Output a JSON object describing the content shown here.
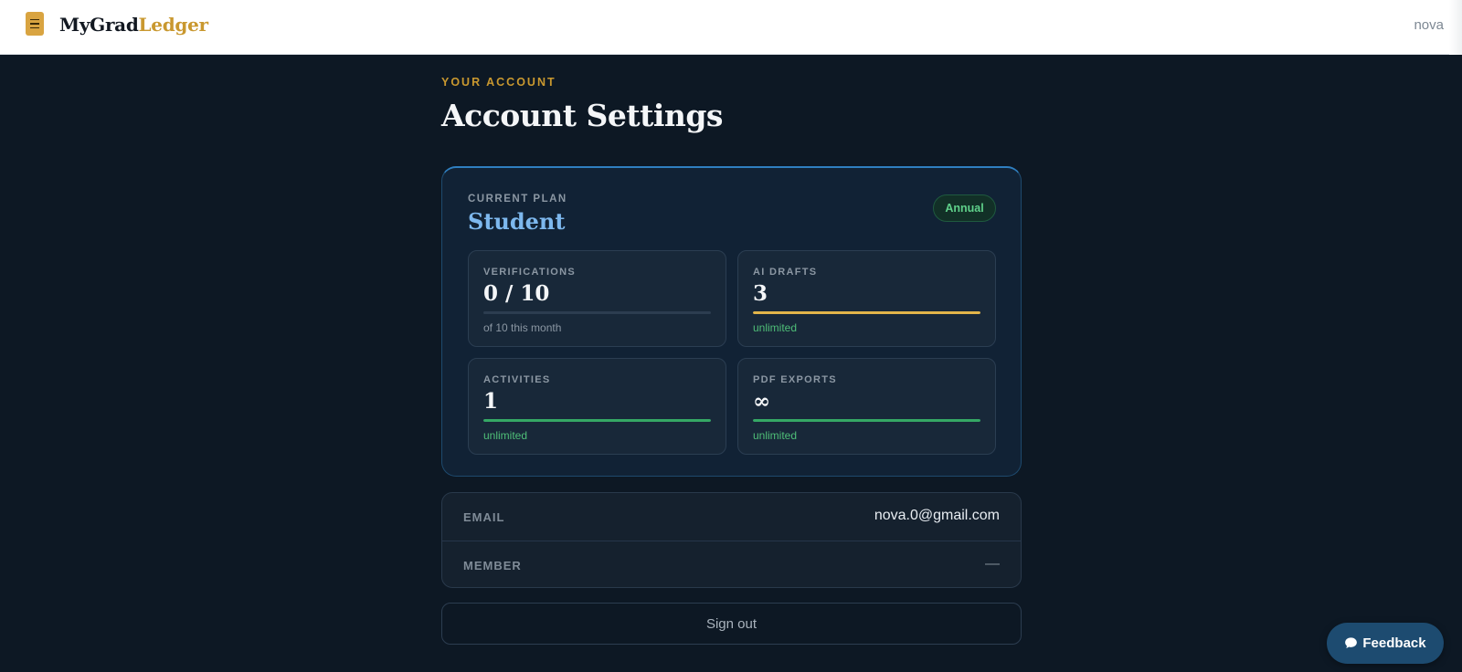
{
  "header": {
    "brand_part1": "MyGrad",
    "brand_part2": "Ledger",
    "user": "nova"
  },
  "page": {
    "eyebrow": "YOUR ACCOUNT",
    "title": "Account Settings"
  },
  "plan": {
    "label": "CURRENT PLAN",
    "name": "Student",
    "badge": "Annual",
    "stats": [
      {
        "label": "VERIFICATIONS",
        "value": "0 / 10",
        "sub": "of 10 this month",
        "progress": 0,
        "bar_color": "#2c3d50"
      },
      {
        "label": "AI DRAFTS",
        "value": "3",
        "sub": "unlimited",
        "progress": 1,
        "bar_color": "#e2b54a"
      },
      {
        "label": "ACTIVITIES",
        "value": "1",
        "sub": "unlimited",
        "progress": 1,
        "bar_color": "#35a865"
      },
      {
        "label": "PDF EXPORTS",
        "value": "∞",
        "sub": "unlimited",
        "progress": 1,
        "bar_color": "#35a865"
      }
    ]
  },
  "account": {
    "email_label": "EMAIL",
    "email_value": "nova.0@gmail.com",
    "member_label": "MEMBER",
    "member_value": "—"
  },
  "actions": {
    "sign_out": "Sign out",
    "feedback": "Feedback"
  },
  "colors": {
    "background": "#0d1824",
    "accent_gold": "#c9982f",
    "plan_blue": "#7db8ee",
    "success_green": "#4fbf78"
  },
  "icons": {
    "menu": "hamburger-menu-icon",
    "feedback": "chat-bubble-icon"
  }
}
